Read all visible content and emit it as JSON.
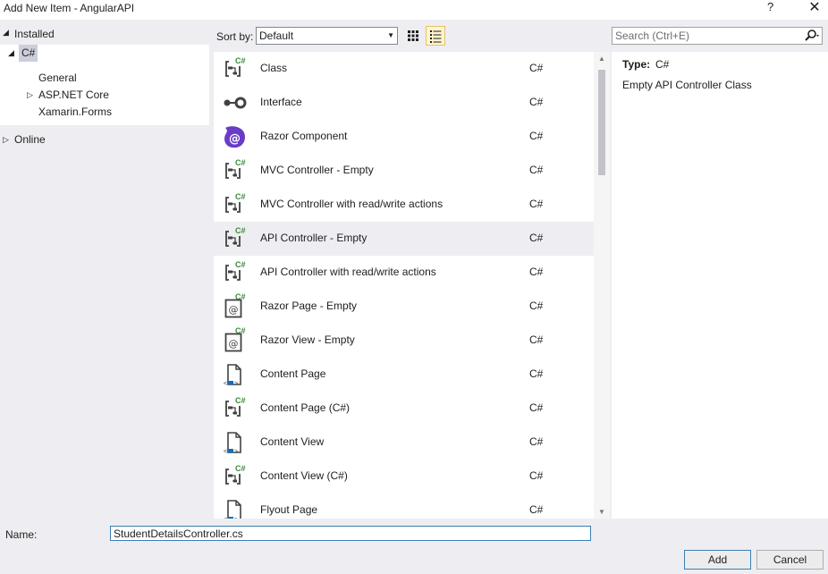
{
  "window": {
    "title": "Add New Item - AngularAPI",
    "help": "?",
    "close": "✕"
  },
  "left_pane": {
    "installed": "Installed",
    "tree": [
      {
        "label": "C#",
        "level": 0,
        "expanded": true,
        "selected": true
      },
      {
        "label": "General",
        "level": 1
      },
      {
        "label": "ASP.NET Core",
        "level": 1,
        "expandable": true
      },
      {
        "label": "Xamarin.Forms",
        "level": 1
      }
    ],
    "online": "Online"
  },
  "toolbar": {
    "sort_by_label": "Sort by:",
    "sort_value": "Default"
  },
  "templates": [
    {
      "name": "Class",
      "lang": "C#",
      "icon": "controller-icon"
    },
    {
      "name": "Interface",
      "lang": "C#",
      "icon": "interface-icon"
    },
    {
      "name": "Razor Component",
      "lang": "C#",
      "icon": "razor-component-icon"
    },
    {
      "name": "MVC Controller - Empty",
      "lang": "C#",
      "icon": "controller-icon"
    },
    {
      "name": "MVC Controller with read/write actions",
      "lang": "C#",
      "icon": "controller-icon"
    },
    {
      "name": "API Controller - Empty",
      "lang": "C#",
      "icon": "controller-icon",
      "selected": true
    },
    {
      "name": "API Controller with read/write actions",
      "lang": "C#",
      "icon": "controller-icon"
    },
    {
      "name": "Razor Page - Empty",
      "lang": "C#",
      "icon": "razor-page-icon"
    },
    {
      "name": "Razor View - Empty",
      "lang": "C#",
      "icon": "razor-page-icon"
    },
    {
      "name": "Content Page",
      "lang": "C#",
      "icon": "content-page-icon"
    },
    {
      "name": "Content Page (C#)",
      "lang": "C#",
      "icon": "controller-icon"
    },
    {
      "name": "Content View",
      "lang": "C#",
      "icon": "content-page-icon"
    },
    {
      "name": "Content View (C#)",
      "lang": "C#",
      "icon": "controller-icon"
    },
    {
      "name": "Flyout Page",
      "lang": "C#",
      "icon": "content-page-icon"
    }
  ],
  "search": {
    "placeholder": "Search (Ctrl+E)"
  },
  "details": {
    "type_label": "Type:",
    "type_value": "C#",
    "description": "Empty API Controller Class"
  },
  "bottom": {
    "name_label": "Name:",
    "name_value": "StudentDetailsController.cs",
    "add_label": "Add",
    "cancel_label": "Cancel"
  },
  "colors": {
    "accent": "#3c7fb1",
    "csharp_green": "#388a34",
    "razor_purple": "#6a3bc7",
    "selection": "#eeeef2"
  }
}
